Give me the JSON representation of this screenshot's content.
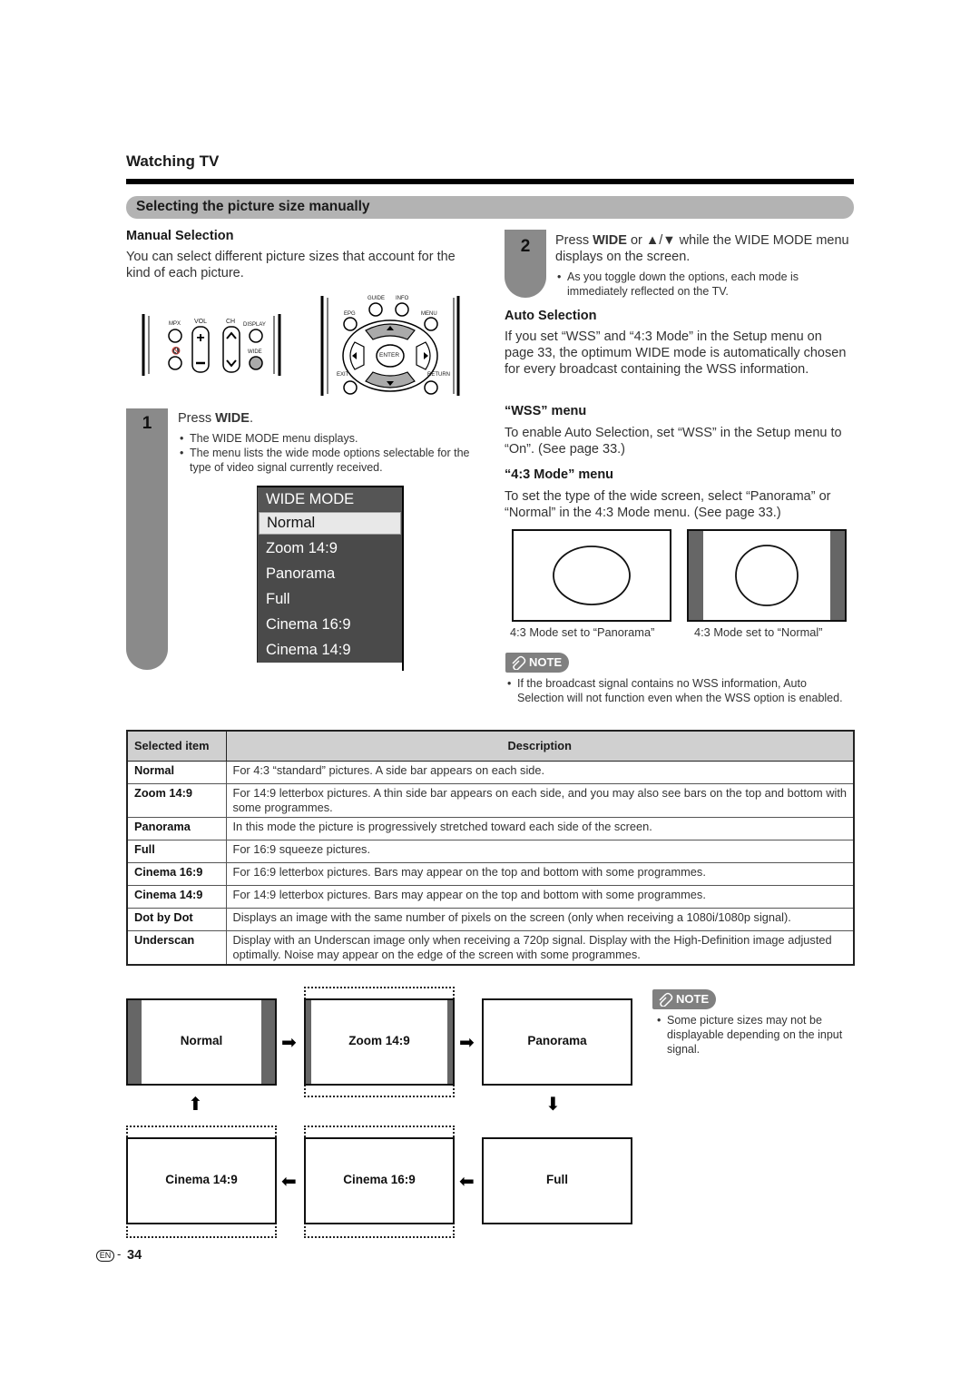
{
  "header": {
    "section_title": "Watching TV",
    "subsection_title": "Selecting the picture size manually"
  },
  "manual_selection": {
    "heading": "Manual Selection",
    "intro": "You can select different picture sizes that account for the kind of each picture."
  },
  "remote": {
    "left_panel": {
      "mpx": "MPX",
      "vol": "VOL",
      "ch": "CH",
      "display": "DISPLAY",
      "wide": "WIDE",
      "mute_icon": "mute-icon"
    },
    "right_panel": {
      "guide": "GUIDE",
      "info": "INFO",
      "epg": "EPG",
      "menu": "MENU",
      "enter": "ENTER",
      "exit": "EXIT",
      "return": "RETURN"
    }
  },
  "step1": {
    "number": "1",
    "instruction_prefix": "Press ",
    "instruction_key": "WIDE",
    "instruction_suffix": ".",
    "bullets": [
      "The WIDE MODE menu displays.",
      "The menu lists the wide mode options selectable for the type of video signal currently received."
    ]
  },
  "wide_mode_menu": {
    "title": "WIDE MODE",
    "items": [
      "Normal",
      "Zoom 14:9",
      "Panorama",
      "Full",
      "Cinema 16:9",
      "Cinema 14:9"
    ],
    "selected": "Normal"
  },
  "step2": {
    "number": "2",
    "instruction_prefix": "Press ",
    "instruction_key": "WIDE",
    "instruction_mid": " or ",
    "instruction_arrows": "▲/▼",
    "instruction_suffix": " while the WIDE MODE menu displays on the screen.",
    "bullets": [
      "As you toggle down the options, each mode is immediately reflected on the TV."
    ]
  },
  "auto_selection": {
    "heading": "Auto Selection",
    "text": "If you set “WSS” and “4:3 Mode” in the Setup menu on page 33, the optimum WIDE mode is automatically chosen for every broadcast containing the WSS information."
  },
  "wss_menu": {
    "heading": "“WSS” menu",
    "text": "To enable Auto Selection, set “WSS” in the Setup menu to “On”. (See page 33.)"
  },
  "mode43_menu": {
    "heading": "“4:3 Mode” menu",
    "text": "To set the type of the wide screen, select “Panorama” or “Normal” in the 4:3 Mode menu. (See page 33.)"
  },
  "mode43_illustrations": [
    {
      "caption": "4:3 Mode set to “Panorama”"
    },
    {
      "caption": "4:3 Mode set to “Normal”"
    }
  ],
  "note1": {
    "badge": "NOTE",
    "bullets": [
      "If the broadcast signal contains no WSS information, Auto Selection will not function even when the WSS option is enabled."
    ]
  },
  "table": {
    "headers": [
      "Selected item",
      "Description"
    ],
    "rows": [
      {
        "item": "Normal",
        "desc": "For 4:3 “standard” pictures. A side bar appears on each side."
      },
      {
        "item": "Zoom 14:9",
        "desc": "For 14:9 letterbox pictures. A thin side bar appears on each side, and you may also see bars on the top and bottom with some programmes."
      },
      {
        "item": "Panorama",
        "desc": "In this mode the picture is progressively stretched toward each side of the screen."
      },
      {
        "item": "Full",
        "desc": "For 16:9 squeeze pictures."
      },
      {
        "item": "Cinema 16:9",
        "desc": "For 16:9 letterbox pictures. Bars may appear on the top and bottom with some programmes."
      },
      {
        "item": "Cinema 14:9",
        "desc": "For 14:9 letterbox pictures. Bars may appear on the top and bottom with some programmes."
      },
      {
        "item": "Dot by Dot",
        "desc": "Displays an image with the same number of pixels on the screen (only when receiving a 1080i/1080p signal)."
      },
      {
        "item": "Underscan",
        "desc": "Display with an Underscan image only when receiving a 720p signal. Display with the High-Definition image adjusted optimally. Noise may appear on the edge of the screen with some programmes."
      }
    ]
  },
  "flow": {
    "boxes": [
      "Normal",
      "Zoom 14:9",
      "Panorama",
      "Full",
      "Cinema 16:9",
      "Cinema 14:9"
    ],
    "arrows": {
      "right": "➡",
      "left": "⬅",
      "up": "⬆",
      "down": "⬇"
    }
  },
  "note2": {
    "badge": "NOTE",
    "bullets": [
      "Some picture sizes may not be displayable depending on the input signal."
    ]
  },
  "footer": {
    "lang_badge": "EN",
    "separator": "-",
    "page_number": "34"
  }
}
